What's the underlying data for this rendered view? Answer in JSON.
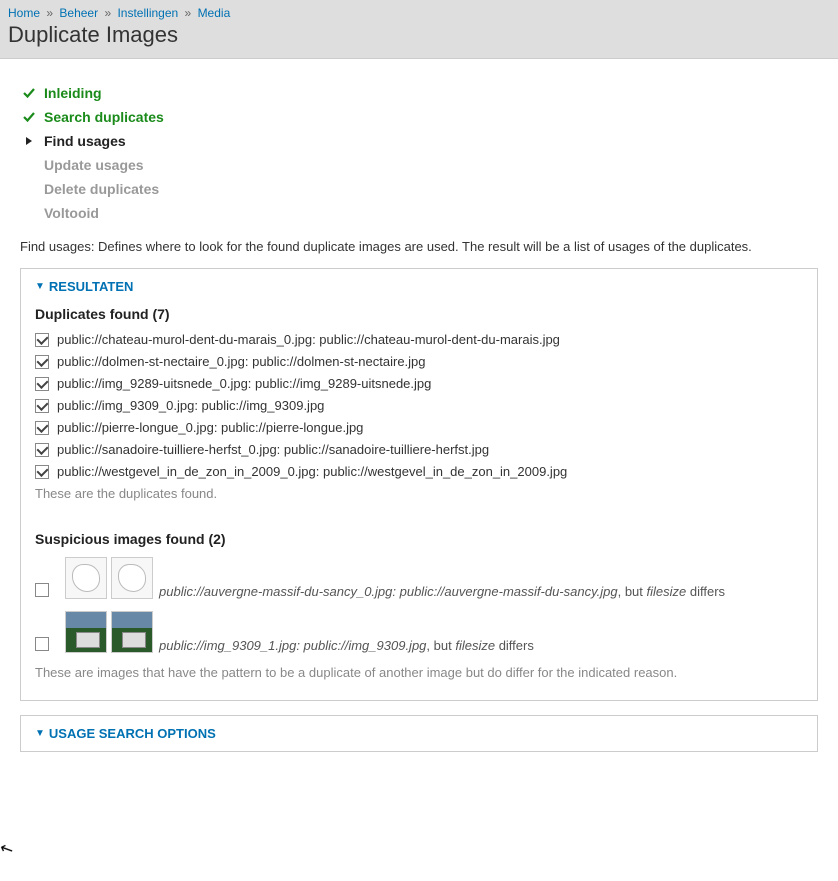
{
  "breadcrumb": {
    "home": "Home",
    "beheer": "Beheer",
    "instellingen": "Instellingen",
    "media": "Media",
    "sep": "»"
  },
  "page_title": "Duplicate Images",
  "steps": {
    "inleiding": "Inleiding",
    "search": "Search duplicates",
    "find": "Find usages",
    "update": "Update usages",
    "delete": "Delete duplicates",
    "voltooid": "Voltooid"
  },
  "description": "Find usages: Defines where to look for the found duplicate images are used. The result will be a list of usages of the duplicates.",
  "results": {
    "panel_title": "RESULTATEN",
    "dups_heading": "Duplicates found (7)",
    "dups": [
      "public://chateau-murol-dent-du-marais_0.jpg: public://chateau-murol-dent-du-marais.jpg",
      "public://dolmen-st-nectaire_0.jpg: public://dolmen-st-nectaire.jpg",
      "public://img_9289-uitsnede_0.jpg: public://img_9289-uitsnede.jpg",
      "public://img_9309_0.jpg: public://img_9309.jpg",
      "public://pierre-longue_0.jpg: public://pierre-longue.jpg",
      "public://sanadoire-tuilliere-herfst_0.jpg: public://sanadoire-tuilliere-herfst.jpg",
      "public://westgevel_in_de_zon_in_2009_0.jpg: public://westgevel_in_de_zon_in_2009.jpg"
    ],
    "dups_hint": "These are the duplicates found.",
    "susp_heading": "Suspicious images found (2)",
    "susp": [
      {
        "path": "public://auvergne-massif-du-sancy_0.jpg: public://auvergne-massif-du-sancy.jpg",
        "but": ", but ",
        "reason": "filesize",
        "differs": " differs",
        "thumb_kind": "map"
      },
      {
        "path": "public://img_9309_1.jpg: public://img_9309.jpg",
        "but": ", but ",
        "reason": "filesize",
        "differs": " differs",
        "thumb_kind": "photo"
      }
    ],
    "susp_hint": "These are images that have the pattern to be a duplicate of another image but do differ for the indicated reason."
  },
  "usage_panel_title": "USAGE SEARCH OPTIONS"
}
